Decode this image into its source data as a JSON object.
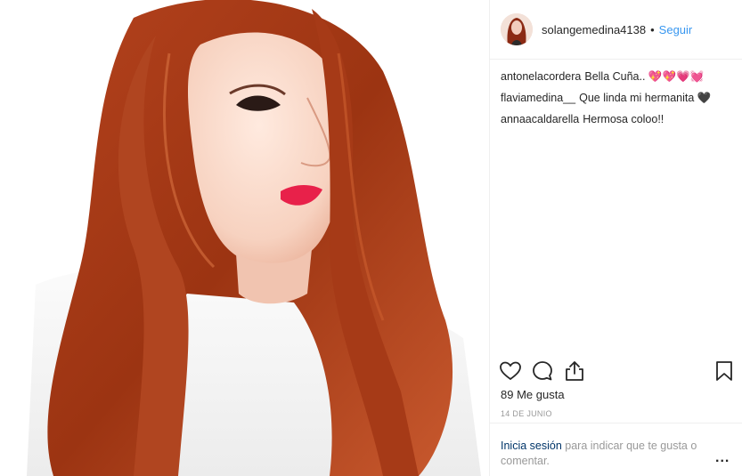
{
  "header": {
    "username": "solangemedina4138",
    "separator": "•",
    "follow_label": "Seguir"
  },
  "comments": [
    {
      "user": "antonelacordera",
      "text": "Bella Cuña.. 💖💖💗💓"
    },
    {
      "user": "flaviamedina__",
      "text": "Que linda mi hermanita 🖤"
    },
    {
      "user": "annaacaldarella",
      "text": "Hermosa coloo!!"
    }
  ],
  "actions": {
    "like_icon": "heart-outline-icon",
    "comment_icon": "speech-bubble-icon",
    "share_icon": "share-upload-icon",
    "save_icon": "bookmark-icon"
  },
  "likes": "89 Me gusta",
  "date": "14 DE JUNIO",
  "footer": {
    "login_link": "Inicia sesión",
    "login_rest": "para indicar que te gusta o comentar.",
    "more_label": "..."
  },
  "colors": {
    "link_blue": "#3897f0",
    "login_blue": "#003569",
    "muted": "#999999",
    "divider": "#efefef"
  }
}
